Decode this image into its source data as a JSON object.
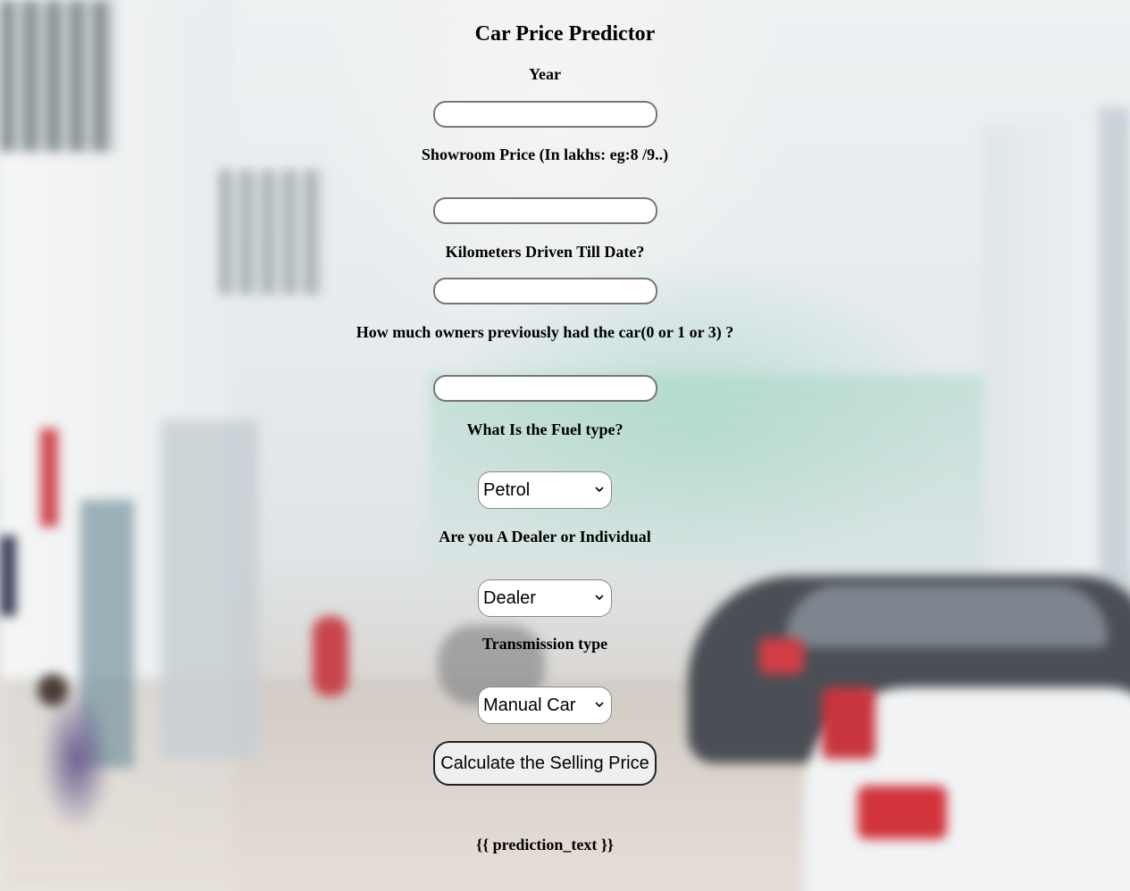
{
  "page": {
    "title": "Car Price Predictor"
  },
  "form": {
    "year": {
      "label": "Year",
      "value": "",
      "placeholder": ""
    },
    "showroom_price": {
      "label": "Showroom Price (In lakhs: eg:8 /9..)",
      "value": "",
      "placeholder": ""
    },
    "kms_driven": {
      "label": "Kilometers Driven Till Date?",
      "value": "",
      "placeholder": ""
    },
    "owners": {
      "label": "How much owners previously had the car(0 or 1 or 3) ?",
      "value": "",
      "placeholder": ""
    },
    "fuel_type": {
      "label": "What Is the Fuel type?",
      "selected": "Petrol"
    },
    "seller_type": {
      "label": "Are you A Dealer or Individual",
      "selected": "Dealer"
    },
    "transmission": {
      "label": "Transmission type",
      "selected": "Manual Car"
    },
    "submit_label": "Calculate the Selling Price"
  },
  "result": {
    "prediction_text": "{{ prediction_text }}"
  },
  "icons": {
    "select_arrow": "chevron-down-icon"
  }
}
